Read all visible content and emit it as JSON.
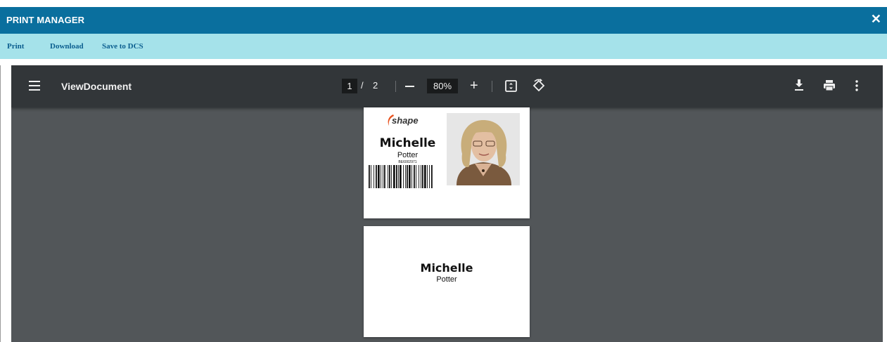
{
  "window": {
    "title": "PRINT MANAGER",
    "close_glyph": "✕",
    "close_icon": "close-icon"
  },
  "menu": {
    "items": [
      "Print",
      "Download",
      "Save to DCS"
    ]
  },
  "viewer": {
    "document_name": "ViewDocument",
    "current_page": "1",
    "page_separator": "/",
    "total_pages": "2",
    "zoom": "80%",
    "zoom_plus": "+",
    "icons": [
      "menu-icon",
      "zoom-out-icon",
      "zoom-in-icon",
      "fit-to-page-icon",
      "rotate-icon",
      "download-icon",
      "print-icon",
      "more-options-icon"
    ]
  },
  "pages": [
    {
      "logo_text": "shape",
      "first_name": "Michelle",
      "last_name": "Potter",
      "id_number": "BE6002971"
    },
    {
      "first_name": "Michelle",
      "last_name": "Potter"
    }
  ],
  "colors": {
    "titlebar": "#0a6f9e",
    "menubar": "#a5e2ea",
    "menu_text": "#0b5e8f",
    "viewer_bg": "#525659",
    "toolbar_bg": "#323639",
    "logo_accent": "#e8501c"
  }
}
